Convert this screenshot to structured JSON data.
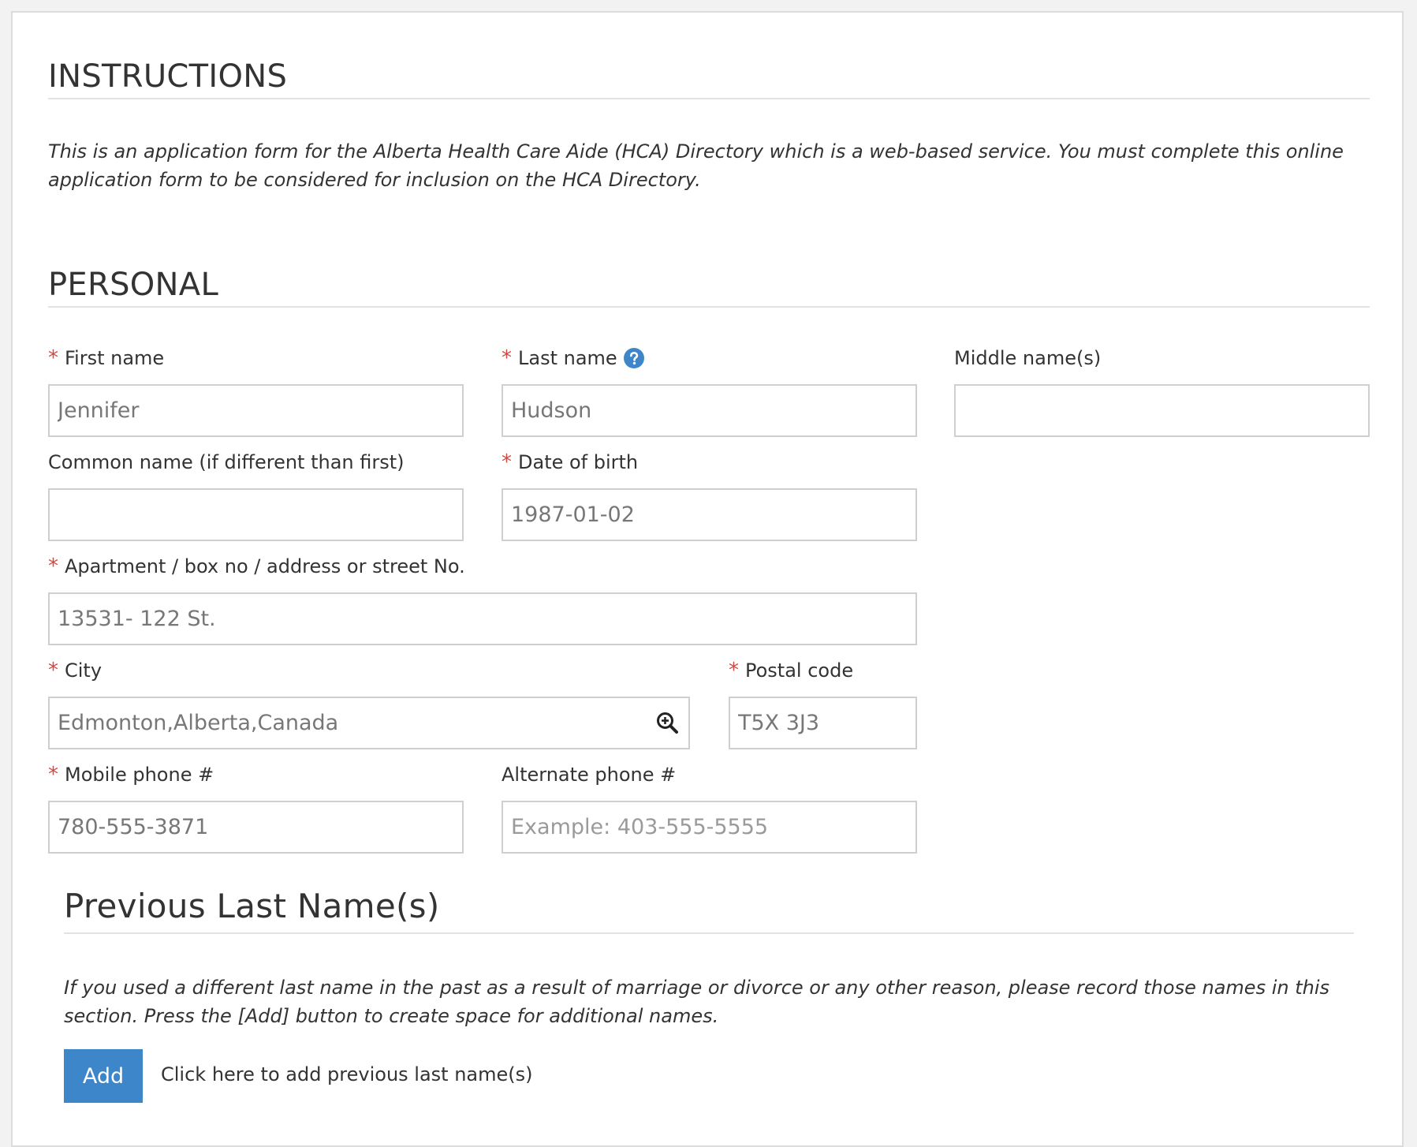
{
  "instructions": {
    "title": "INSTRUCTIONS",
    "text": "This is an application form for the Alberta Health Care Aide (HCA) Directory which is a web-based service. You must complete this online application form to be considered for inclusion on the HCA Directory."
  },
  "personal": {
    "title": "PERSONAL",
    "required_marker": "*",
    "fields": {
      "first_name": {
        "label": "First name",
        "value": "Jennifer",
        "required": true
      },
      "last_name": {
        "label": "Last name",
        "value": "Hudson",
        "required": true
      },
      "middle_names": {
        "label": "Middle name(s)",
        "value": "",
        "required": false
      },
      "common_name": {
        "label": "Common name (if different than first)",
        "value": "",
        "required": false
      },
      "date_of_birth": {
        "label": "Date of birth",
        "value": "1987-01-02",
        "required": true
      },
      "address": {
        "label": "Apartment / box no / address or street No.",
        "value": "13531- 122 St.",
        "required": true
      },
      "city": {
        "label": "City",
        "value": "Edmonton,Alberta,Canada",
        "required": true
      },
      "postal_code": {
        "label": "Postal code",
        "value": "T5X 3J3",
        "required": true
      },
      "mobile_phone": {
        "label": "Mobile phone #",
        "value": "780-555-3871",
        "required": true
      },
      "alternate_phone": {
        "label": "Alternate phone #",
        "value": "",
        "placeholder": "Example: 403-555-5555",
        "required": false
      }
    }
  },
  "previous_last_names": {
    "title": "Previous Last Name(s)",
    "text": "If you used a different last name in the past as a result of marriage or divorce or any other reason, please record those names in this section. Press the [Add] button to create space for additional names.",
    "add_label": "Add",
    "add_hint": "Click here to add previous last name(s)"
  },
  "icons": {
    "help": "question-circle-icon",
    "city_lookup": "zoom-in-search-icon"
  },
  "colors": {
    "required": "#d9463c",
    "accent": "#3d86c9",
    "help_icon": "#3d86c9"
  }
}
